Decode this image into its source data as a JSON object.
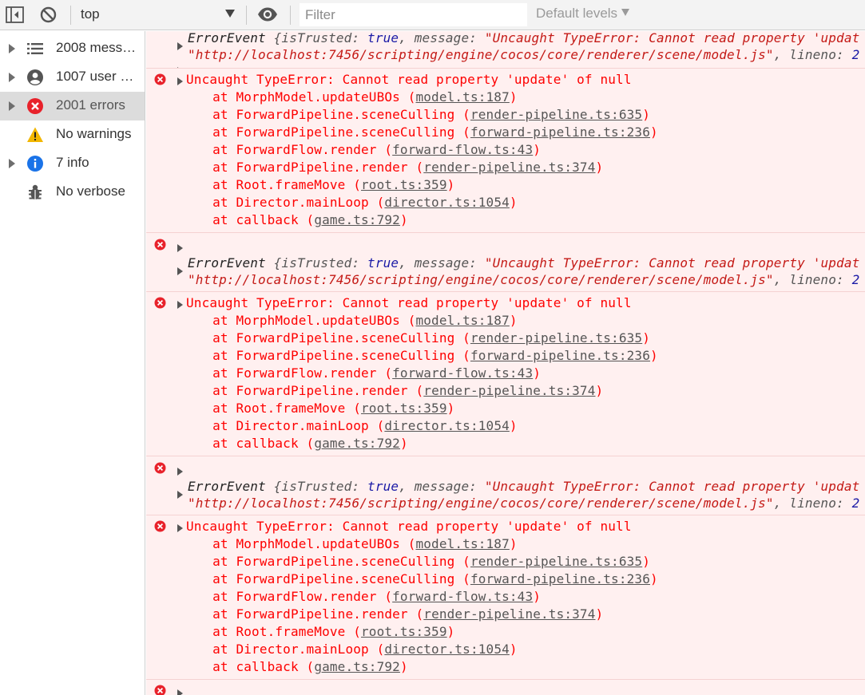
{
  "toolbar": {
    "context": "top",
    "filter_placeholder": "Filter",
    "levels": "Default levels"
  },
  "sidebar": {
    "items": [
      {
        "label": "2008 messa…",
        "icon": "list-icon",
        "expandable": true,
        "selected": false
      },
      {
        "label": "1007 user m…",
        "icon": "user-icon",
        "expandable": true,
        "selected": false
      },
      {
        "label": "2001 errors",
        "icon": "error-icon",
        "expandable": true,
        "selected": true
      },
      {
        "label": "No warnings",
        "icon": "warning-icon",
        "expandable": false,
        "selected": false
      },
      {
        "label": "7 info",
        "icon": "info-icon",
        "expandable": true,
        "selected": false
      },
      {
        "label": "No verbose",
        "icon": "bug-icon",
        "expandable": false,
        "selected": false
      }
    ]
  },
  "colors": {
    "error_text": "#fe0000",
    "error_bg": "#fff0f0",
    "error_border": "#f5d2d2",
    "selected_bg": "#dcdcdc",
    "info_blue": "#1a73e8",
    "warning_yellow": "#f2b600"
  },
  "console": {
    "event": {
      "name": "ErrorEvent",
      "open": "{",
      "k_trusted": "isTrusted:",
      "v_trusted": "true",
      "k_message": "message:",
      "v_message": "\"Uncaught TypeError: Cannot read property 'updat",
      "url": "\"http://localhost:7456/scripting/engine/cocos/core/renderer/scene/model.js\"",
      "k_lineno": "lineno:",
      "v_lineno": "2"
    },
    "error": {
      "message": "Uncaught TypeError: Cannot read property 'update' of null",
      "stack": [
        {
          "fn": "    at MorphModel.updateUBOs (",
          "link": "model.ts:187",
          "end": ")"
        },
        {
          "fn": "    at ForwardPipeline.sceneCulling (",
          "link": "render-pipeline.ts:635",
          "end": ")"
        },
        {
          "fn": "    at ForwardPipeline.sceneCulling (",
          "link": "forward-pipeline.ts:236",
          "end": ")"
        },
        {
          "fn": "    at ForwardFlow.render (",
          "link": "forward-flow.ts:43",
          "end": ")"
        },
        {
          "fn": "    at ForwardPipeline.render (",
          "link": "render-pipeline.ts:374",
          "end": ")"
        },
        {
          "fn": "    at Root.frameMove (",
          "link": "root.ts:359",
          "end": ")"
        },
        {
          "fn": "    at Director.mainLoop (",
          "link": "director.ts:1054",
          "end": ")"
        },
        {
          "fn": "    at callback (",
          "link": "game.ts:792",
          "end": ")"
        }
      ]
    }
  }
}
